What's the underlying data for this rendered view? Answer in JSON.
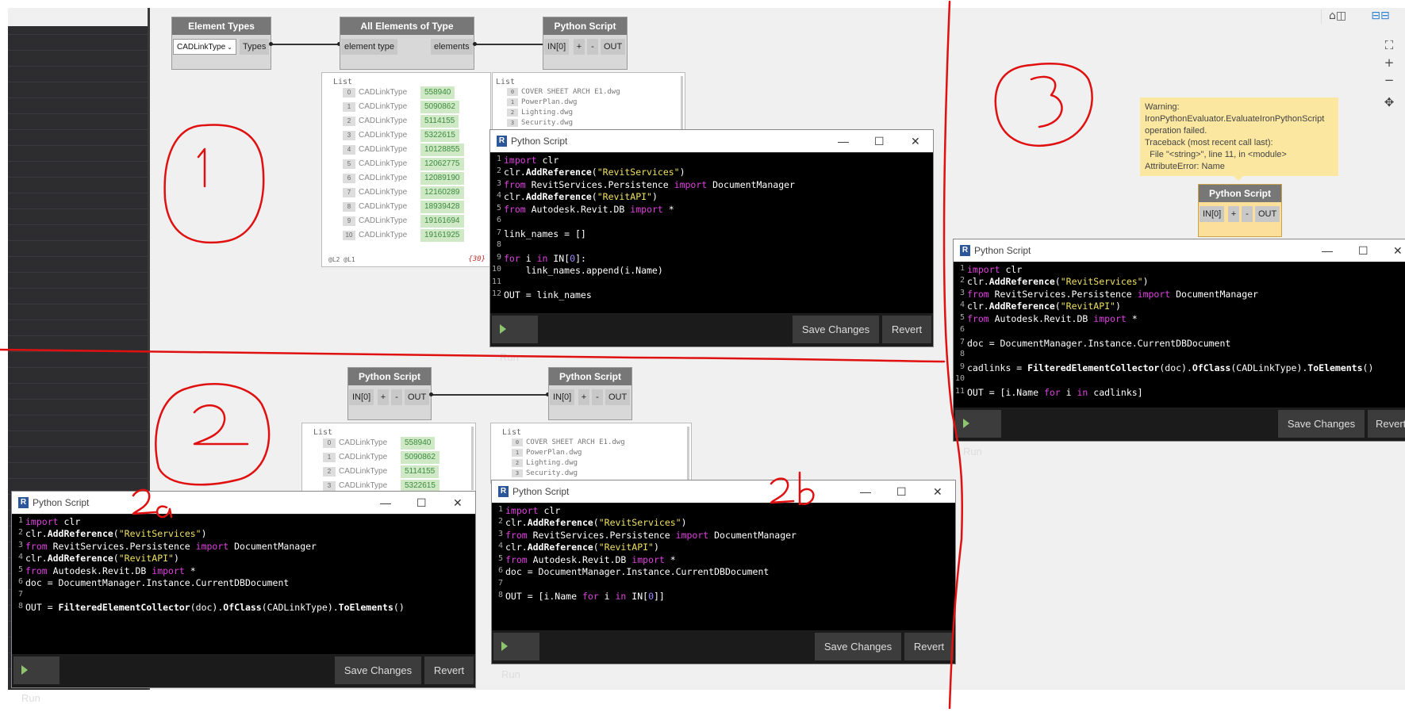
{
  "nodes": {
    "element_types": {
      "title": "Element Types",
      "dropdown_value": "CADLinkType",
      "out_port": "Types"
    },
    "all_elements": {
      "title": "All Elements of Type",
      "in_port": "element type",
      "out_port": "elements"
    },
    "python_script": {
      "title": "Python Script",
      "in_port": "IN[0]",
      "add": "+",
      "remove": "-",
      "out_port": "OUT"
    }
  },
  "preview_1a": {
    "header": "List",
    "rows": [
      {
        "idx": "0",
        "type": "CADLinkType",
        "val": "558940"
      },
      {
        "idx": "1",
        "type": "CADLinkType",
        "val": "5090862"
      },
      {
        "idx": "2",
        "type": "CADLinkType",
        "val": "5114155"
      },
      {
        "idx": "3",
        "type": "CADLinkType",
        "val": "5322615"
      },
      {
        "idx": "4",
        "type": "CADLinkType",
        "val": "10128855"
      },
      {
        "idx": "5",
        "type": "CADLinkType",
        "val": "12062775"
      },
      {
        "idx": "6",
        "type": "CADLinkType",
        "val": "12089190"
      },
      {
        "idx": "7",
        "type": "CADLinkType",
        "val": "12160289"
      },
      {
        "idx": "8",
        "type": "CADLinkType",
        "val": "18939428"
      },
      {
        "idx": "9",
        "type": "CADLinkType",
        "val": "19161694"
      },
      {
        "idx": "10",
        "type": "CADLinkType",
        "val": "19161925"
      }
    ],
    "footer": "@L2 @L1",
    "count": "{30}"
  },
  "preview_1b": {
    "header": "List",
    "rows": [
      {
        "idx": "0",
        "name": "COVER SHEET ARCH E1.dwg"
      },
      {
        "idx": "1",
        "name": "PowerPlan.dwg"
      },
      {
        "idx": "2",
        "name": "Lighting.dwg"
      },
      {
        "idx": "3",
        "name": "Security.dwg"
      }
    ]
  },
  "preview_2a": {
    "header": "List",
    "rows": [
      {
        "idx": "0",
        "type": "CADLinkType",
        "val": "558940"
      },
      {
        "idx": "1",
        "type": "CADLinkType",
        "val": "5090862"
      },
      {
        "idx": "2",
        "type": "CADLinkType",
        "val": "5114155"
      },
      {
        "idx": "3",
        "type": "CADLinkType",
        "val": "5322615"
      }
    ]
  },
  "preview_2b": {
    "header": "List",
    "rows": [
      {
        "idx": "0",
        "name": "COVER SHEET ARCH E1.dwg"
      },
      {
        "idx": "1",
        "name": "PowerPlan.dwg"
      },
      {
        "idx": "2",
        "name": "Lighting.dwg"
      },
      {
        "idx": "3",
        "name": "Security.dwg"
      }
    ]
  },
  "editor_common": {
    "title": "Python Script",
    "run": "Run",
    "save": "Save Changes",
    "revert": "Revert",
    "minimize": "—",
    "maximize": "☐",
    "close": "✕"
  },
  "editor_1": {
    "lines": [
      {
        "n": "1",
        "code": "import clr"
      },
      {
        "n": "2",
        "code": "clr.AddReference(\"RevitServices\")"
      },
      {
        "n": "3",
        "code": "from RevitServices.Persistence import DocumentManager"
      },
      {
        "n": "4",
        "code": "clr.AddReference(\"RevitAPI\")"
      },
      {
        "n": "5",
        "code": "from Autodesk.Revit.DB import *"
      },
      {
        "n": "6",
        "code": ""
      },
      {
        "n": "7",
        "code": "link_names = []"
      },
      {
        "n": "8",
        "code": ""
      },
      {
        "n": "9",
        "code": "for i in IN[0]:"
      },
      {
        "n": "10",
        "code": "    link_names.append(i.Name)"
      },
      {
        "n": "11",
        "code": ""
      },
      {
        "n": "12",
        "code": "OUT = link_names"
      }
    ]
  },
  "editor_2a": {
    "lines": [
      {
        "n": "1",
        "code": "import clr"
      },
      {
        "n": "2",
        "code": "clr.AddReference(\"RevitServices\")"
      },
      {
        "n": "3",
        "code": "from RevitServices.Persistence import DocumentManager"
      },
      {
        "n": "4",
        "code": "clr.AddReference(\"RevitAPI\")"
      },
      {
        "n": "5",
        "code": "from Autodesk.Revit.DB import *"
      },
      {
        "n": "6",
        "code": "doc = DocumentManager.Instance.CurrentDBDocument"
      },
      {
        "n": "7",
        "code": ""
      },
      {
        "n": "8",
        "code": "OUT = FilteredElementCollector(doc).OfClass(CADLinkType).ToElements()"
      }
    ]
  },
  "editor_2b": {
    "lines": [
      {
        "n": "1",
        "code": "import clr"
      },
      {
        "n": "2",
        "code": "clr.AddReference(\"RevitServices\")"
      },
      {
        "n": "3",
        "code": "from RevitServices.Persistence import DocumentManager"
      },
      {
        "n": "4",
        "code": "clr.AddReference(\"RevitAPI\")"
      },
      {
        "n": "5",
        "code": "from Autodesk.Revit.DB import *"
      },
      {
        "n": "6",
        "code": "doc = DocumentManager.Instance.CurrentDBDocument"
      },
      {
        "n": "7",
        "code": ""
      },
      {
        "n": "8",
        "code": "OUT = [i.Name for i in IN[0]]"
      }
    ]
  },
  "editor_3": {
    "lines": [
      {
        "n": "1",
        "code": "import clr"
      },
      {
        "n": "2",
        "code": "clr.AddReference(\"RevitServices\")"
      },
      {
        "n": "3",
        "code": "from RevitServices.Persistence import DocumentManager"
      },
      {
        "n": "4",
        "code": "clr.AddReference(\"RevitAPI\")"
      },
      {
        "n": "5",
        "code": "from Autodesk.Revit.DB import *"
      },
      {
        "n": "6",
        "code": ""
      },
      {
        "n": "7",
        "code": "doc = DocumentManager.Instance.CurrentDBDocument"
      },
      {
        "n": "8",
        "code": ""
      },
      {
        "n": "9",
        "code": "cadlinks = FilteredElementCollector(doc).OfClass(CADLinkType).ToElements()"
      },
      {
        "n": "10",
        "code": ""
      },
      {
        "n": "11",
        "code": "OUT = [i.Name for i in cadlinks]"
      }
    ]
  },
  "warning": {
    "lines": [
      "Warning:",
      "IronPythonEvaluator.EvaluateIronPythonScript",
      "operation failed.",
      "Traceback (most recent call last):",
      "  File \"<string>\", line 11, in <module>",
      "AttributeError: Name"
    ]
  },
  "toolbar": {
    "zoom_fit": "⛶",
    "zoom_in": "+",
    "zoom_out": "−",
    "pan": "✥"
  },
  "annotations": {
    "label_2a": "2a",
    "label_2b": "2b",
    "color": "#e01010"
  }
}
